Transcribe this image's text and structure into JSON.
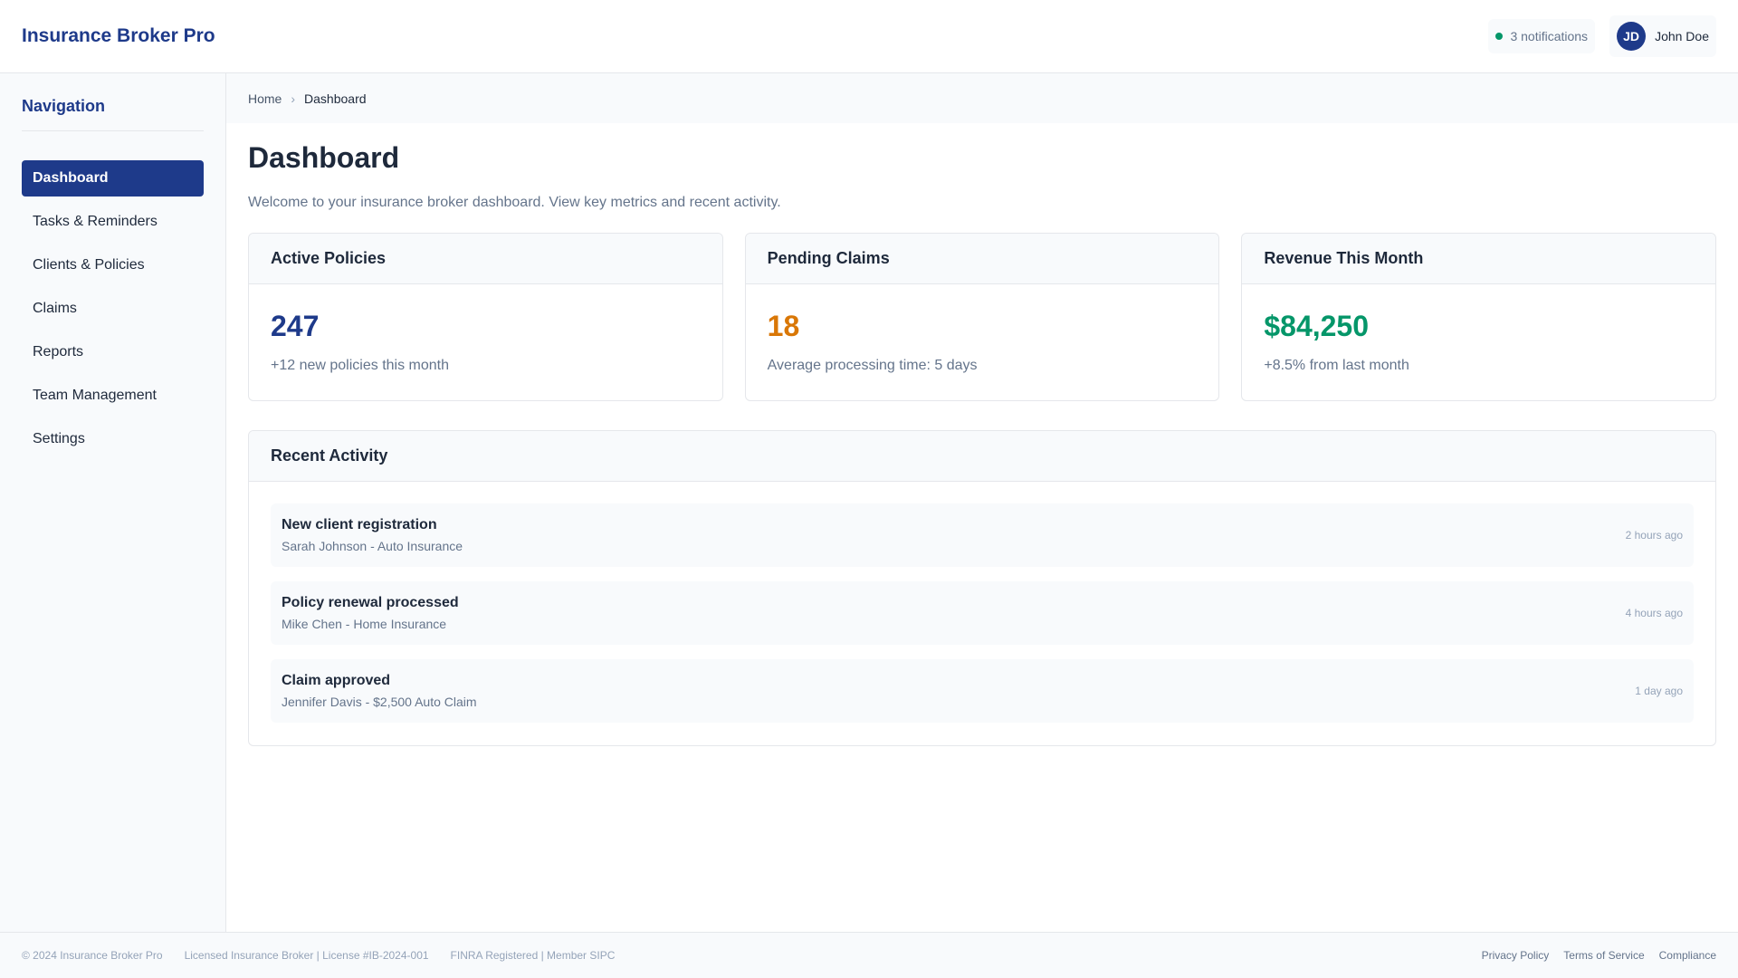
{
  "header": {
    "brand": "Insurance Broker Pro",
    "notifications": "3 notifications",
    "user": {
      "initials": "JD",
      "name": "John Doe"
    }
  },
  "sidebar": {
    "title": "Navigation",
    "items": [
      {
        "label": "Dashboard",
        "active": true
      },
      {
        "label": "Tasks & Reminders"
      },
      {
        "label": "Clients & Policies"
      },
      {
        "label": "Claims"
      },
      {
        "label": "Reports"
      },
      {
        "label": "Team Management"
      },
      {
        "label": "Settings"
      }
    ]
  },
  "breadcrumb": {
    "home": "Home",
    "separator": "›",
    "current": "Dashboard"
  },
  "main": {
    "title": "Dashboard",
    "subtitle": "Welcome to your insurance broker dashboard. View key metrics and recent activity.",
    "cards": [
      {
        "title": "Active Policies",
        "value": "247",
        "sub": "+12 new policies this month",
        "color": "#1e3a8a"
      },
      {
        "title": "Pending Claims",
        "value": "18",
        "sub": "Average processing time: 5 days",
        "color": "#d97706"
      },
      {
        "title": "Revenue This Month",
        "value": "$84,250",
        "sub": "+8.5% from last month",
        "color": "#059669"
      }
    ],
    "activity": {
      "title": "Recent Activity",
      "items": [
        {
          "title": "New client registration",
          "desc": "Sarah Johnson - Auto Insurance",
          "time": "2 hours ago"
        },
        {
          "title": "Policy renewal processed",
          "desc": "Mike Chen - Home Insurance",
          "time": "4 hours ago"
        },
        {
          "title": "Claim approved",
          "desc": "Jennifer Davis - $2,500 Auto Claim",
          "time": "1 day ago"
        }
      ]
    }
  },
  "footer": {
    "left": [
      "© 2024 Insurance Broker Pro",
      "Licensed Insurance Broker | License #IB-2024-001",
      "FINRA Registered | Member SIPC"
    ],
    "links": [
      "Privacy Policy",
      "Terms of Service",
      "Compliance"
    ]
  },
  "colors": {
    "brand": "#1e3a8a",
    "warning": "#d97706",
    "success": "#059669",
    "status_dot": "#059669"
  }
}
